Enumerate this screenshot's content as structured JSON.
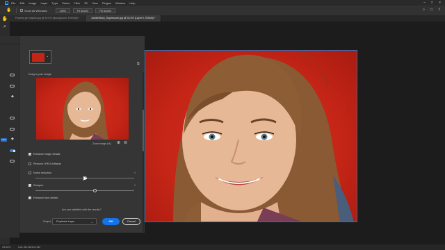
{
  "menubar": {
    "items": [
      "File",
      "Edit",
      "Image",
      "Layer",
      "Type",
      "Select",
      "Filter",
      "3D",
      "View",
      "Plugins",
      "Window",
      "Help"
    ]
  },
  "options": {
    "scroll_all_label": "Scroll All Windows",
    "zoom_value": "100%",
    "fit_screen_label": "Fit Screen",
    "fill_screen_label": "Fill Screen"
  },
  "tabs": [
    {
      "label": "Flowers girl original.jpg @ 49.5% (Background, RGB/8#) *"
    },
    {
      "label": "AdobeStock_Supersoom.jpg @ 33.3% (Layer 0, RGB/8) *"
    }
  ],
  "dialog": {
    "drag_label": "Drag to pan image",
    "zoom_label": "Zoom image (%)",
    "options": [
      {
        "label": "Enhance image details",
        "checked": true,
        "value": ""
      },
      {
        "label": "Remove JPEG Artifacts",
        "checked": false,
        "value": ""
      },
      {
        "label": "Noise reduction",
        "checked": false,
        "value": "0"
      },
      {
        "label": "Sharpen",
        "checked": true,
        "value": "0"
      },
      {
        "label": "Enhance face details",
        "checked": true,
        "value": ""
      }
    ],
    "noise_reduction_level": 0.5,
    "sharpen_level": 0.6,
    "satisfied_text": "Are you satisfied with the results?",
    "output_label": "Output",
    "output_value": "Duplicate Layer",
    "ok_label": "OK",
    "cancel_label": "Cancel"
  },
  "leftstrip": {
    "new_badge": "New"
  },
  "status": {
    "zoom": "33.33%",
    "doc": "Doc: 86.1M/131.3M"
  },
  "colors": {
    "accent": "#1473e6",
    "background_red": "#c42516"
  }
}
